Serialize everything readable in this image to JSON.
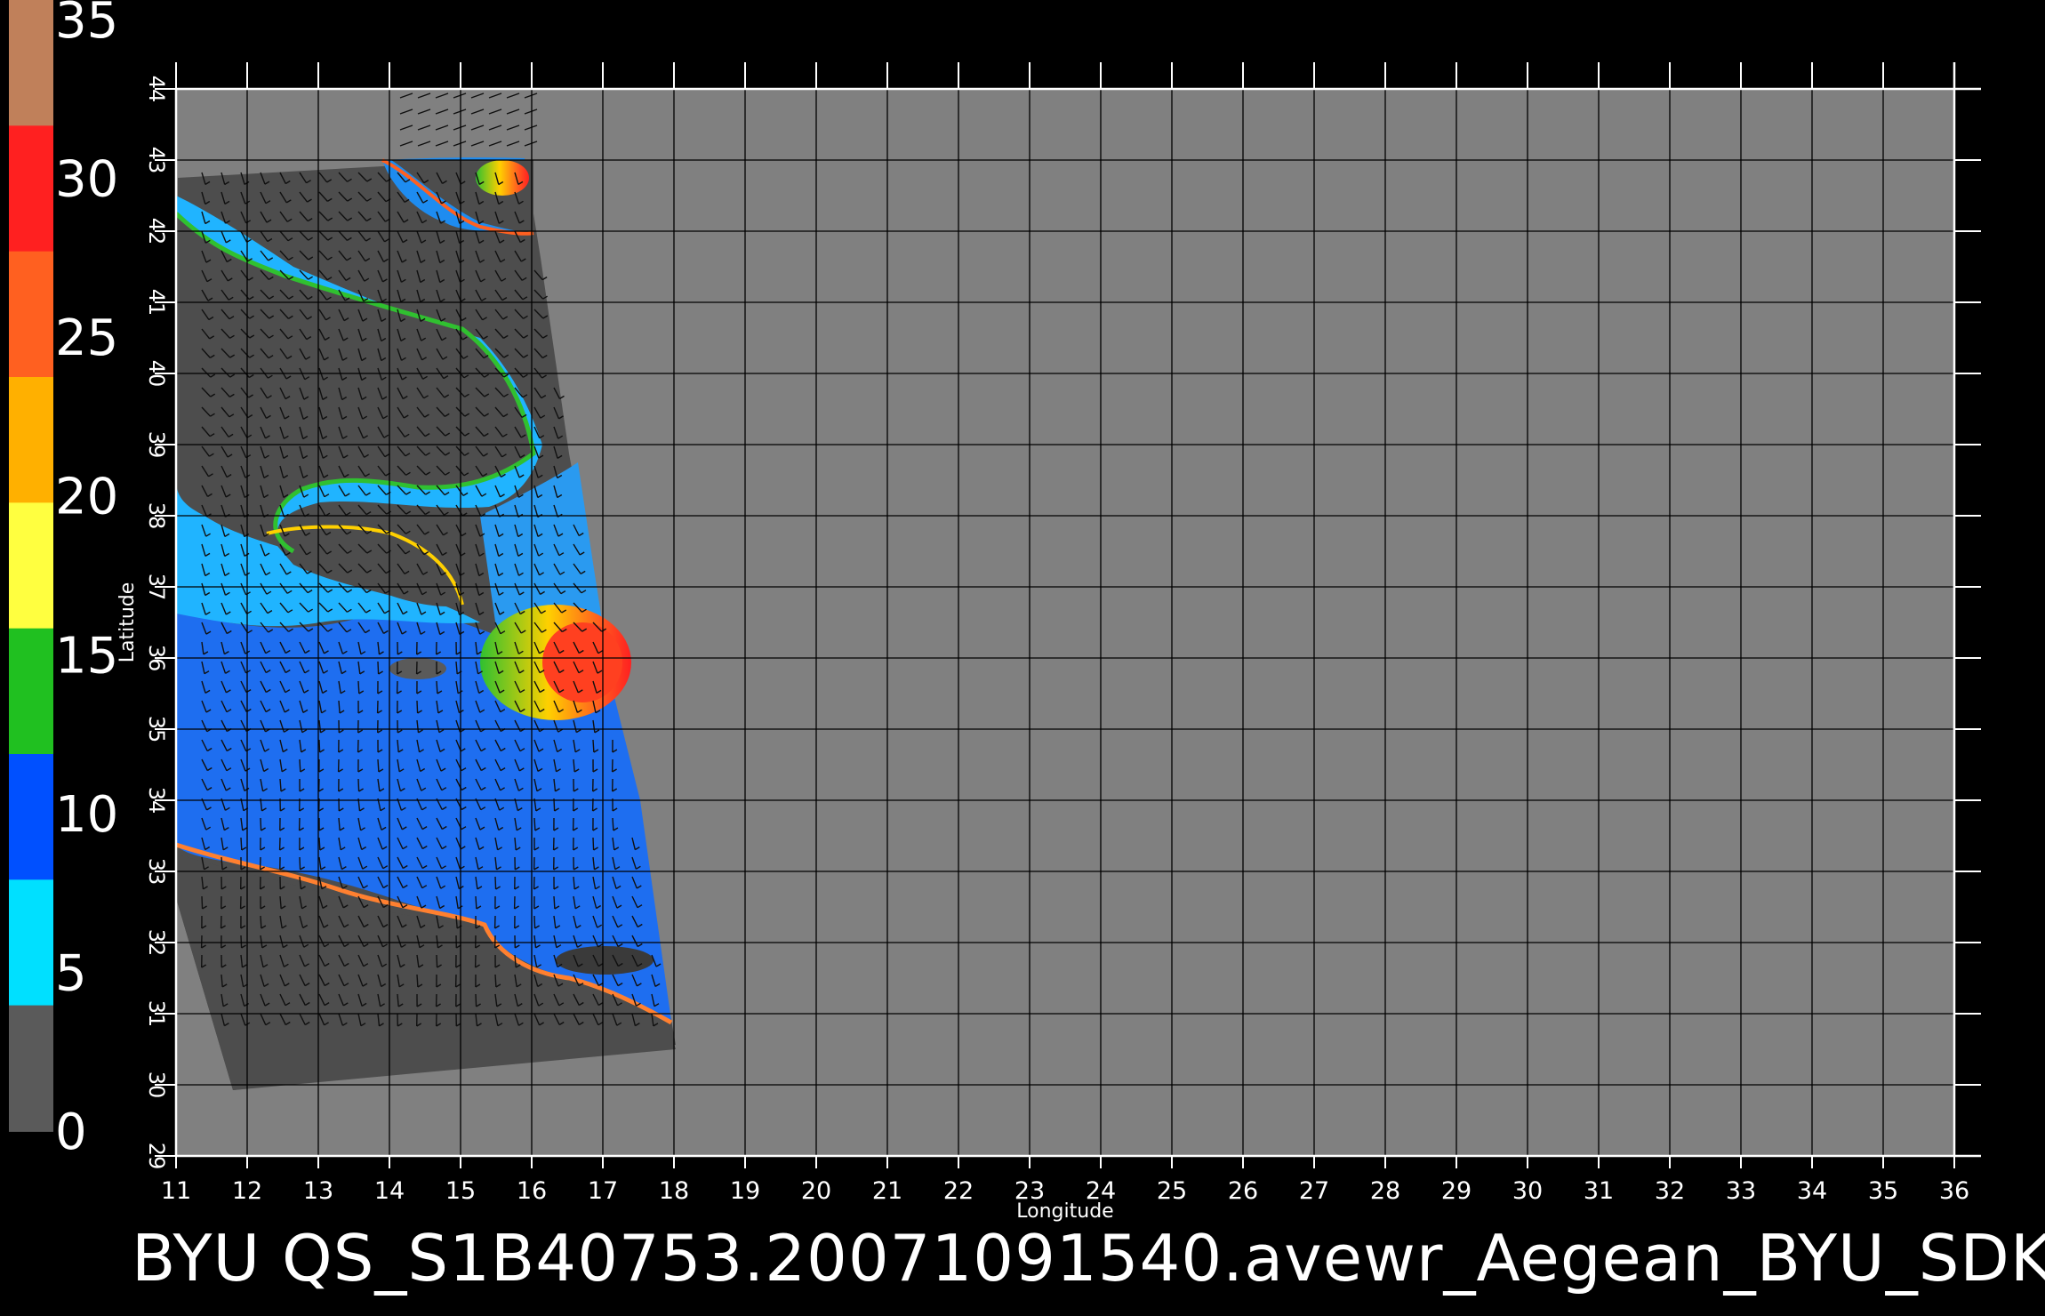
{
  "title": "BYU  QS_S1B40753.20071091540.avewr_Aegean_BYU_SDK",
  "x_axis": {
    "label": "Longitude",
    "ticks": [
      "11",
      "12",
      "13",
      "14",
      "15",
      "16",
      "17",
      "18",
      "19",
      "20",
      "21",
      "22",
      "23",
      "24",
      "25",
      "26",
      "27",
      "28",
      "29",
      "30",
      "31",
      "32",
      "33",
      "34",
      "35",
      "36"
    ]
  },
  "y_axis": {
    "label": "Latitude",
    "ticks": [
      "29",
      "30",
      "31",
      "32",
      "33",
      "34",
      "35",
      "36",
      "37",
      "38",
      "39",
      "40",
      "41",
      "42",
      "43",
      "44"
    ]
  },
  "colorbar": {
    "labels": [
      "35",
      "30",
      "25",
      "20",
      "15",
      "10",
      "5",
      "0"
    ],
    "segments": [
      "#c0805a",
      "#ff2020",
      "#ff6020",
      "#ffb000",
      "#ffff40",
      "#20c020",
      "#0050ff",
      "#00e0ff",
      "#505050"
    ]
  },
  "colors": {
    "background": "#000000",
    "map_fill": "#808080",
    "swath_fill": "#4d4d4d",
    "gridline": "#000000",
    "axis": "#ffffff",
    "wind_blue": "#1e6ef0",
    "wind_cyan": "#20c8ff",
    "wind_green": "#30c030",
    "wind_red": "#ff3020"
  }
}
